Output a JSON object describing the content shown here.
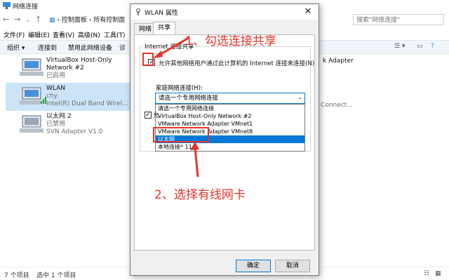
{
  "explorer": {
    "title": "网络连接",
    "breadcrumb": [
      "控制面板",
      "所有控制面"
    ],
    "breadcrumb_sep": "›",
    "search_placeholder": "搜索\"网络连接\"",
    "menus": [
      "文件(F)",
      "编辑(E)",
      "查看(V)",
      "高级(N)",
      "工具(T)"
    ],
    "commands": [
      "组织 ▾",
      "连接到",
      "禁用此网络设备",
      "诊"
    ],
    "connections": [
      {
        "name": "VirtualBox Host-Only Network #2",
        "line1": "VirtualBox Host-Only",
        "line2": "Network #2",
        "status": "已启用",
        "selected": false
      },
      {
        "name": "WLAN",
        "line1": "WLAN",
        "network": "chy",
        "adapter": "Intel(R) Dual Band Wirel...",
        "selected": true
      },
      {
        "name": "以太网 2",
        "line1": "以太网 2",
        "status": "已禁用",
        "adapter": "SVN Adapter V1.0",
        "selected": false
      }
    ],
    "right_partial_1": "k Adapter",
    "right_partial_2": "Connect...",
    "status_count": "7 个项目",
    "status_selected": "选中 1 个项目"
  },
  "dialog": {
    "title": "WLAN 属性",
    "tabs": [
      "网络",
      "共享"
    ],
    "active_tab": "共享",
    "group_title": "Internet 连接共享",
    "allow_checkbox_label": "允许其他网络用户通过此计算机的 Internet 连接来连接(N)",
    "allow_checked": true,
    "home_network_label": "家庭网络连接(H):",
    "dropdown_value": "请选一个专用网络连接",
    "options": [
      "请选一个专用网络连接",
      "VirtualBox Host-Only Network #2",
      "VMware Network Adapter VMnet1",
      "VMware Network Adapter VMnet8",
      "以太网",
      "本地连接* 11"
    ],
    "selected_option": "以太网",
    "second_checkbox_label": "允",
    "ok_label": "确定",
    "cancel_label": "取消"
  },
  "annotations": {
    "step1": "1、勾选连接共享",
    "step2": "2、选择有线网卡",
    "color": "#e8332a"
  }
}
